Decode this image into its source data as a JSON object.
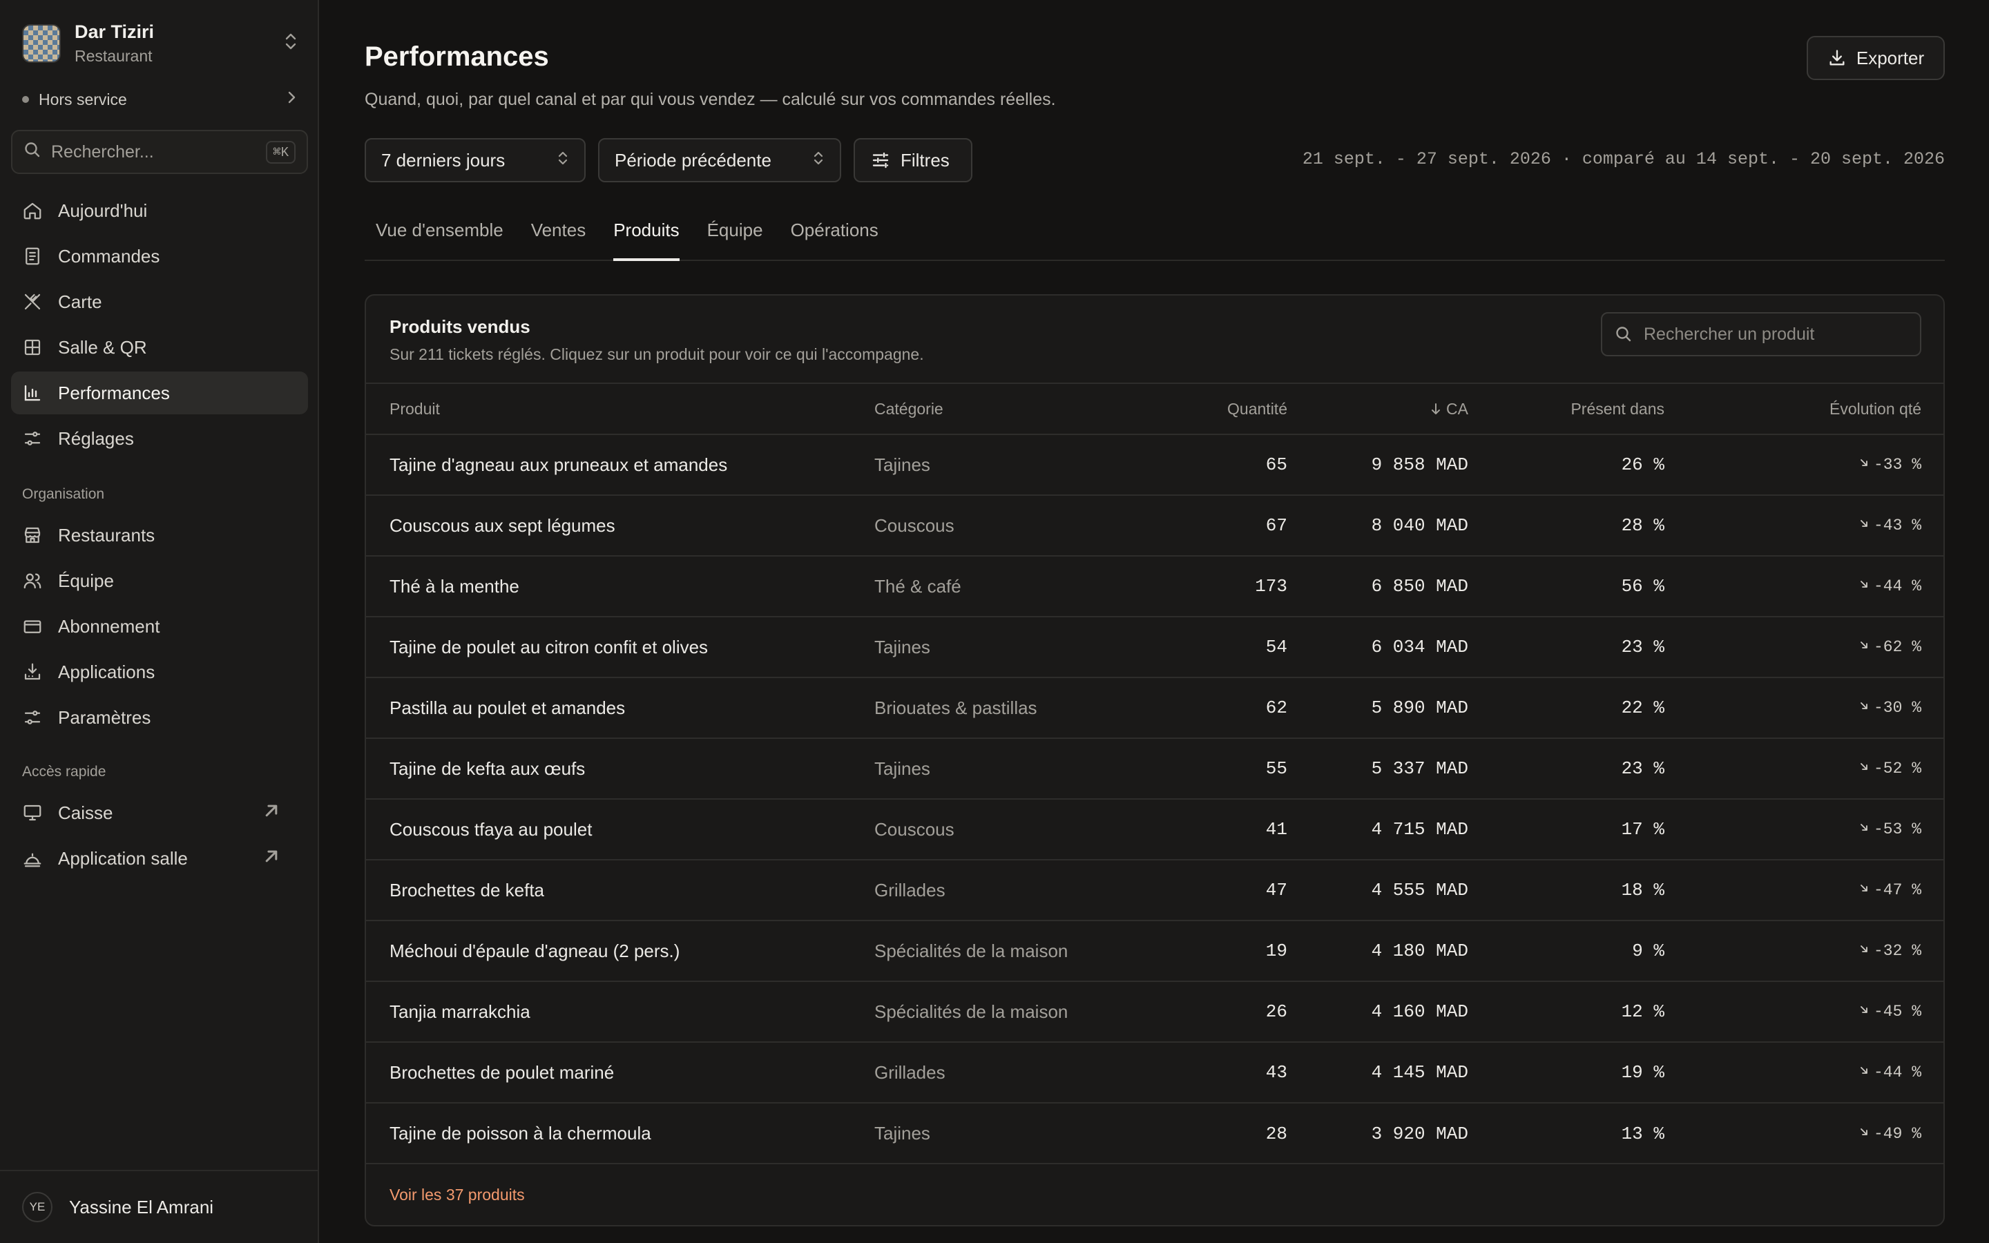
{
  "workspace": {
    "name": "Dar Tiziri",
    "type": "Restaurant"
  },
  "status": {
    "label": "Hors service"
  },
  "sidebar_search": {
    "placeholder": "Rechercher...",
    "shortcut": "⌘K"
  },
  "nav": {
    "main": [
      {
        "label": "Aujourd'hui",
        "icon": "home-icon"
      },
      {
        "label": "Commandes",
        "icon": "receipt-icon"
      },
      {
        "label": "Carte",
        "icon": "utensils-icon"
      },
      {
        "label": "Salle & QR",
        "icon": "grid-icon"
      },
      {
        "label": "Performances",
        "icon": "bar-chart-icon",
        "active": true
      },
      {
        "label": "Réglages",
        "icon": "sliders-icon"
      }
    ],
    "organisation_label": "Organisation",
    "organisation": [
      {
        "label": "Restaurants",
        "icon": "store-icon"
      },
      {
        "label": "Équipe",
        "icon": "users-icon"
      },
      {
        "label": "Abonnement",
        "icon": "credit-card-icon"
      },
      {
        "label": "Applications",
        "icon": "download-icon"
      },
      {
        "label": "Paramètres",
        "icon": "settings-icon"
      }
    ],
    "quick_label": "Accès rapide",
    "quick": [
      {
        "label": "Caisse",
        "icon": "monitor-icon"
      },
      {
        "label": "Application salle",
        "icon": "cloche-icon"
      }
    ]
  },
  "user": {
    "initials": "YE",
    "name": "Yassine El Amrani"
  },
  "page": {
    "title": "Performances",
    "subtitle": "Quand, quoi, par quel canal et par qui vous vendez — calculé sur vos commandes réelles.",
    "export_label": "Exporter"
  },
  "filters": {
    "period": "7 derniers jours",
    "compare": "Période précédente",
    "filters_label": "Filtres",
    "date_range": "21 sept. - 27 sept. 2026 · comparé au 14 sept. - 20 sept. 2026"
  },
  "tabs": [
    "Vue d'ensemble",
    "Ventes",
    "Produits",
    "Équipe",
    "Opérations"
  ],
  "active_tab": "Produits",
  "products_card": {
    "title": "Produits vendus",
    "subtitle": "Sur 211 tickets réglés. Cliquez sur un produit pour voir ce qui l'accompagne.",
    "search_placeholder": "Rechercher un produit",
    "columns": {
      "product": "Produit",
      "category": "Catégorie",
      "quantity": "Quantité",
      "revenue": "CA",
      "presence": "Présent dans",
      "evolution": "Évolution qté"
    },
    "sort_column": "revenue",
    "rows": [
      {
        "product": "Tajine d'agneau aux pruneaux et amandes",
        "category": "Tajines",
        "quantity": "65",
        "revenue": "9 858 MAD",
        "presence": "26 %",
        "evolution": "-33 %"
      },
      {
        "product": "Couscous aux sept légumes",
        "category": "Couscous",
        "quantity": "67",
        "revenue": "8 040 MAD",
        "presence": "28 %",
        "evolution": "-43 %"
      },
      {
        "product": "Thé à la menthe",
        "category": "Thé & café",
        "quantity": "173",
        "revenue": "6 850 MAD",
        "presence": "56 %",
        "evolution": "-44 %"
      },
      {
        "product": "Tajine de poulet au citron confit et olives",
        "category": "Tajines",
        "quantity": "54",
        "revenue": "6 034 MAD",
        "presence": "23 %",
        "evolution": "-62 %"
      },
      {
        "product": "Pastilla au poulet et amandes",
        "category": "Briouates & pastillas",
        "quantity": "62",
        "revenue": "5 890 MAD",
        "presence": "22 %",
        "evolution": "-30 %"
      },
      {
        "product": "Tajine de kefta aux œufs",
        "category": "Tajines",
        "quantity": "55",
        "revenue": "5 337 MAD",
        "presence": "23 %",
        "evolution": "-52 %"
      },
      {
        "product": "Couscous tfaya au poulet",
        "category": "Couscous",
        "quantity": "41",
        "revenue": "4 715 MAD",
        "presence": "17 %",
        "evolution": "-53 %"
      },
      {
        "product": "Brochettes de kefta",
        "category": "Grillades",
        "quantity": "47",
        "revenue": "4 555 MAD",
        "presence": "18 %",
        "evolution": "-47 %"
      },
      {
        "product": "Méchoui d'épaule d'agneau (2 pers.)",
        "category": "Spécialités de la maison",
        "quantity": "19",
        "revenue": "4 180 MAD",
        "presence": "9 %",
        "evolution": "-32 %"
      },
      {
        "product": "Tanjia marrakchia",
        "category": "Spécialités de la maison",
        "quantity": "26",
        "revenue": "4 160 MAD",
        "presence": "12 %",
        "evolution": "-45 %"
      },
      {
        "product": "Brochettes de poulet mariné",
        "category": "Grillades",
        "quantity": "43",
        "revenue": "4 145 MAD",
        "presence": "19 %",
        "evolution": "-44 %"
      },
      {
        "product": "Tajine de poisson à la chermoula",
        "category": "Tajines",
        "quantity": "28",
        "revenue": "3 920 MAD",
        "presence": "13 %",
        "evolution": "-49 %"
      }
    ],
    "see_all_label": "Voir les 37 produits"
  },
  "colors": {
    "background": "#141312",
    "sidebar": "#1B1A19",
    "accent_link": "#F39A6E"
  }
}
